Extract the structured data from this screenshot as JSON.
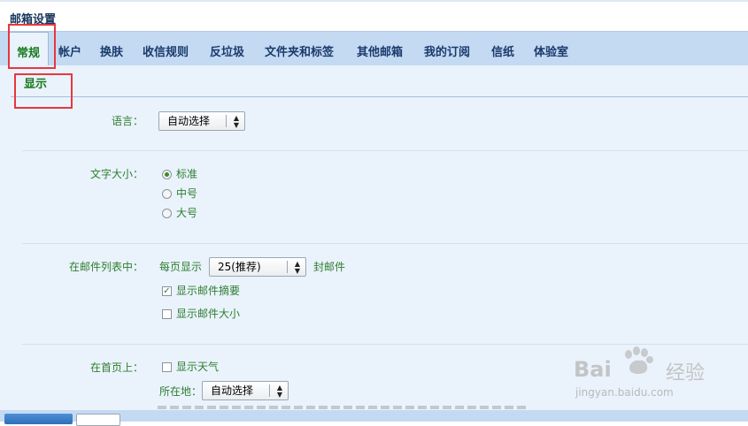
{
  "page": {
    "title": "邮箱设置"
  },
  "tabs": [
    "常规",
    "帐户",
    "换肤",
    "收信规则",
    "反垃圾",
    "文件夹和标签",
    "其他邮箱",
    "我的订阅",
    "信纸",
    "体验室"
  ],
  "active_tab": "常规",
  "subtab": "显示",
  "language": {
    "label": "语言：",
    "selected": "自动选择"
  },
  "font_size": {
    "label": "文字大小：",
    "options": [
      "标准",
      "中号",
      "大号"
    ],
    "selected": "标准"
  },
  "mail_list": {
    "label": "在邮件列表中：",
    "per_page_label": "每页显示",
    "per_page_value": "25(推荐)",
    "unit": "封邮件",
    "show_summary": {
      "label": "显示邮件摘要",
      "checked": true
    },
    "show_size": {
      "label": "显示邮件大小",
      "checked": false
    }
  },
  "home": {
    "label": "在首页上：",
    "show_weather": {
      "label": "显示天气",
      "checked": false
    },
    "location_label": "所在地：",
    "location_value": "自动选择"
  },
  "watermark": {
    "brand_a": "Bai",
    "brand_b": "经验",
    "url": "jingyan.baidu.com"
  },
  "colors": {
    "accent_green": "#157a1d",
    "tab_bar": "#c4daf3",
    "annotation_red": "#e8373f"
  }
}
